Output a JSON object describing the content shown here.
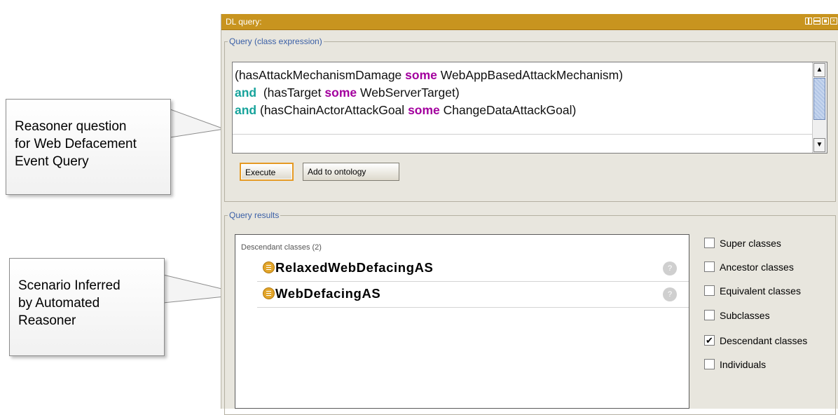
{
  "callouts": {
    "query_note": [
      "Reasoner question",
      "for Web Defacement",
      "Event Query"
    ],
    "result_note": [
      "Scenario Inferred",
      "by Automated",
      "Reasoner"
    ]
  },
  "window": {
    "title": "DL query:",
    "controls": [
      "restore-icon",
      "minimize-icon",
      "maximize-icon",
      "close-icon"
    ]
  },
  "query": {
    "legend": "Query (class expression)",
    "lines": [
      [
        {
          "text": "(hasAttackMechanismDamage ",
          "kind": "plain"
        },
        {
          "text": "some",
          "kind": "some"
        },
        {
          "text": " WebAppBasedAttackMechanism)",
          "kind": "plain"
        }
      ],
      [
        {
          "text": "and",
          "kind": "and"
        },
        {
          "text": "  (hasTarget ",
          "kind": "plain"
        },
        {
          "text": "some",
          "kind": "some"
        },
        {
          "text": " WebServerTarget)",
          "kind": "plain"
        }
      ],
      [
        {
          "text": "and",
          "kind": "and"
        },
        {
          "text": " (hasChainActorAttackGoal ",
          "kind": "plain"
        },
        {
          "text": "some",
          "kind": "some"
        },
        {
          "text": " ChangeDataAttackGoal)",
          "kind": "plain"
        }
      ]
    ],
    "execute_label": "Execute",
    "add_label": "Add to ontology"
  },
  "results": {
    "legend": "Query results",
    "heading": "Descendant classes (2)",
    "items": [
      {
        "name": "RelaxedWebDefacingAS",
        "help": "?"
      },
      {
        "name": "WebDefacingAS",
        "help": "?"
      }
    ],
    "options": [
      {
        "label": "Super classes",
        "checked": false
      },
      {
        "label": "Ancestor classes",
        "checked": false
      },
      {
        "label": "Equivalent classes",
        "checked": false
      },
      {
        "label": "Subclasses",
        "checked": false
      },
      {
        "label": "Descendant classes",
        "checked": true
      },
      {
        "label": "Individuals",
        "checked": false
      }
    ]
  },
  "colors": {
    "titlebar": "#c8941f",
    "keyword_some": "#a3009e",
    "keyword_and": "#17a39b",
    "legend_text": "#3a5fa6",
    "execute_border": "#e59a24",
    "class_icon": "#e2a52a"
  }
}
